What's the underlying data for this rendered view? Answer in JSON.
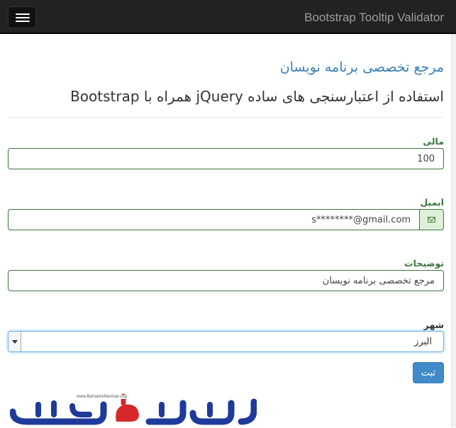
{
  "navbar": {
    "brand": "Bootstrap Tooltip Validator",
    "toggle_icon": "hamburger-icon"
  },
  "header": {
    "site_title": "مرجع تخصصی برنامه نویسان",
    "page_title": "استفاده از اعتبارسنجی های ساده jQuery همراه با Bootstrap"
  },
  "form": {
    "amount": {
      "label": "مالی",
      "value": "100"
    },
    "email": {
      "label": "ایمیل",
      "value": "s********@gmail.com",
      "icon": "envelope-icon"
    },
    "description": {
      "label": "توضیحات",
      "value": "مرجع تخصصی برنامه نویسان"
    },
    "city": {
      "label": "شهر",
      "selected": "البرز"
    },
    "submit_label": "ثبت"
  },
  "logo": {
    "text": "برنامه نویسان",
    "url": "www.BarnameNevisan.org"
  },
  "colors": {
    "navbar_bg": "#222222",
    "success": "#3c763d",
    "primary": "#428bca",
    "title_blue": "#3a7fb5"
  }
}
